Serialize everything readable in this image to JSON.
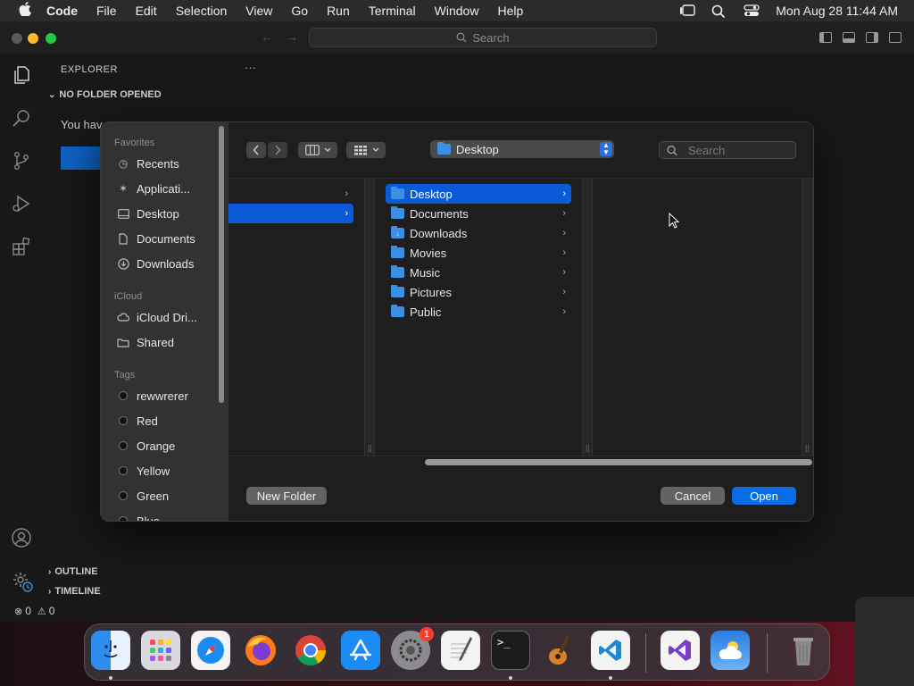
{
  "menubar": {
    "app_name": "Code",
    "items": [
      "File",
      "Edit",
      "Selection",
      "View",
      "Go",
      "Run",
      "Terminal",
      "Window",
      "Help"
    ],
    "clock": "Mon Aug 28  11:44 AM"
  },
  "vscode": {
    "command_center_placeholder": "Search",
    "explorer_title": "EXPLORER",
    "no_folder": "NO FOLDER OPENED",
    "no_folder_text": "You hav",
    "outline": "OUTLINE",
    "timeline": "TIMELINE",
    "status": {
      "errors": "0",
      "warnings": "0"
    }
  },
  "dialog": {
    "sidebar": {
      "favorites_label": "Favorites",
      "favorites": [
        {
          "label": "Recents",
          "icon": "clock-icon"
        },
        {
          "label": "Applicati...",
          "icon": "applications-icon"
        },
        {
          "label": "Desktop",
          "icon": "desktop-icon"
        },
        {
          "label": "Documents",
          "icon": "document-icon"
        },
        {
          "label": "Downloads",
          "icon": "download-icon"
        }
      ],
      "icloud_label": "iCloud",
      "icloud": [
        {
          "label": "iCloud Dri...",
          "icon": "cloud-icon"
        },
        {
          "label": "Shared",
          "icon": "shared-folder-icon"
        }
      ],
      "tags_label": "Tags",
      "tags": [
        "rewwrerer",
        "Red",
        "Orange",
        "Yellow",
        "Green",
        "Blue"
      ]
    },
    "location": "Desktop",
    "search_placeholder": "Search",
    "columns": {
      "middle": [
        "Desktop",
        "Documents",
        "Downloads",
        "Movies",
        "Music",
        "Pictures",
        "Public"
      ],
      "selected": "Desktop"
    },
    "buttons": {
      "new_folder": "New Folder",
      "cancel": "Cancel",
      "open": "Open"
    }
  },
  "dock": {
    "apps": [
      "Finder",
      "Launchpad",
      "Safari",
      "Firefox",
      "Chrome",
      "App Store",
      "System Settings",
      "TextEdit",
      "Terminal",
      "GarageBand",
      "Visual Studio Code",
      "Visual Studio",
      "Weather",
      "Trash"
    ],
    "settings_badge": "1"
  }
}
